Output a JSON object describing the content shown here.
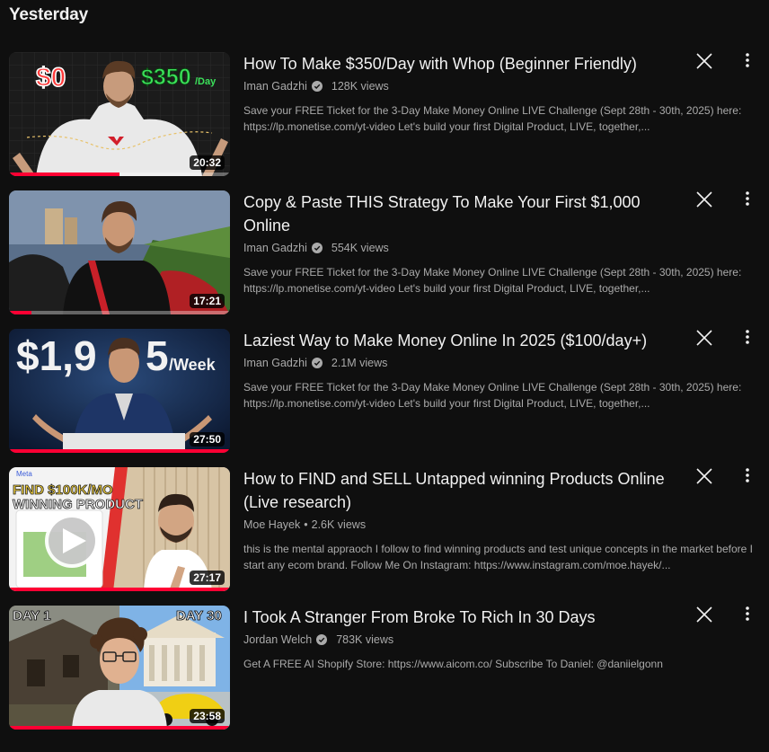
{
  "section": {
    "title": "Yesterday"
  },
  "colors": {
    "background": "#0f0f0f",
    "progress": "#ff0033",
    "meta_text": "#aaaaaa"
  },
  "videos": [
    {
      "title": "How To Make $350/Day with Whop (Beginner Friendly)",
      "channel": "Iman Gadzhi",
      "verified": true,
      "views": "128K views",
      "description": "Save your FREE Ticket for the 3-Day Make Money Online LIVE Challenge (Sept 28th - 30th, 2025) here: https://lp.monetise.com/yt-video Let's build your first Digital Product, LIVE, together,...",
      "duration": "20:32",
      "watched_fraction": 0.5,
      "thumb_text": {
        "left": "$0",
        "right": "$350",
        "right_suffix": "/Day"
      }
    },
    {
      "title": "Copy & Paste THIS Strategy To Make Your First $1,000 Online",
      "channel": "Iman Gadzhi",
      "verified": true,
      "views": "554K views",
      "description": "Save your FREE Ticket for the 3-Day Make Money Online LIVE Challenge (Sept 28th - 30th, 2025) here: https://lp.monetise.com/yt-video Let's build your first Digital Product, LIVE, together,...",
      "duration": "17:21",
      "watched_fraction": 0.1
    },
    {
      "title": "Laziest Way to Make Money Online In 2025 ($100/day+)",
      "channel": "Iman Gadzhi",
      "verified": true,
      "views": "2.1M views",
      "description": "Save your FREE Ticket for the 3-Day Make Money Online LIVE Challenge (Sept 28th - 30th, 2025) here: https://lp.monetise.com/yt-video Let's build your first Digital Product, LIVE, together,...",
      "duration": "27:50",
      "watched_fraction": 1.0,
      "thumb_text": {
        "big": "$1,9",
        "big2": "5",
        "suffix": "/Week"
      }
    },
    {
      "title": "How to FIND and SELL Untapped winning Products Online (Live research)",
      "channel": "Moe Hayek",
      "verified": false,
      "views": "2.6K views",
      "description": "this is the mental appraoch I follow to find winning products and test unique concepts in the market before I start any ecom brand. Follow Me On Instagram: https://www.instagram.com/moe.hayek/...",
      "duration": "27:17",
      "watched_fraction": 1.0,
      "thumb_text": {
        "brand": "Meta",
        "line1": "FIND $100K/MO",
        "line2": "WINNING PRODUCT"
      }
    },
    {
      "title": "I Took A Stranger From Broke To Rich In 30 Days",
      "channel": "Jordan Welch",
      "verified": true,
      "views": "783K views",
      "description": "Get A FREE AI Shopify Store: https://www.aicom.co/ Subscribe To Daniel: @daniielgonn",
      "duration": "23:58",
      "watched_fraction": 1.0,
      "thumb_text": {
        "left": "DAY 1",
        "right": "DAY 30"
      }
    }
  ]
}
